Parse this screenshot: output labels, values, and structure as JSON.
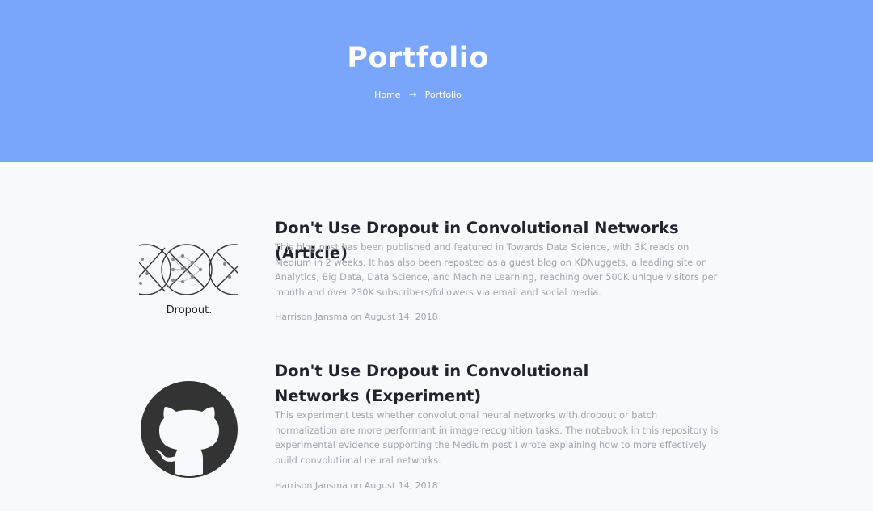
{
  "header": {
    "title": "Portfolio",
    "breadcrumb": {
      "home": "Home",
      "arrow": "→",
      "current": "Portfolio"
    }
  },
  "posts": [
    {
      "title": "Don't Use Dropout in Convolutional Networks (Article)",
      "description": "This blog post has been published and featured in Towards Data Science, with 3K reads on Medium in 2 weeks. It has also been reposted as a guest blog on KDNuggets, a leading site on Analytics, Big Data, Data Science, and Machine Learning, reaching over 500K unique visitors per month and over 230K subscribers/followers via email and social media.",
      "meta": "Harrison Jansma on August 14, 2018",
      "thumbnail_caption": "Dropout.",
      "thumbnail_icon": "dropout-network-icon"
    },
    {
      "title": "Don't Use Dropout in Convolutional Networks (Experiment)",
      "description": "This experiment tests whether convolutional neural networks with dropout or batch normalization are more performant in image recognition tasks. The notebook in this repository is experimental evidence supporting the Medium post I wrote explaining how to more effectively build convolutional neural networks.",
      "meta": "Harrison Jansma on August 14, 2018",
      "thumbnail_icon": "github-octocat-icon"
    }
  ],
  "colors": {
    "hero_bg": "#79a6fb",
    "page_bg": "#f8f9fd",
    "title": "#23232c",
    "muted": "#a3a3ab"
  }
}
